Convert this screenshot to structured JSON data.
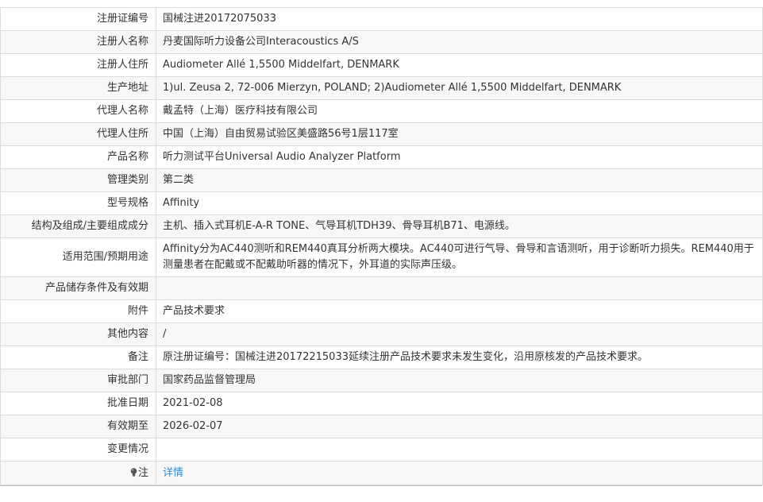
{
  "rows": [
    {
      "label": "注册证编号",
      "value": "国械注进20172075033"
    },
    {
      "label": "注册人名称",
      "value": "丹麦国际听力设备公司Interacoustics A/S"
    },
    {
      "label": "注册人住所",
      "value": "Audiometer Allé 1,5500 Middelfart, DENMARK"
    },
    {
      "label": "生产地址",
      "value": "1)ul. Zeusa 2, 72-006 Mierzyn, POLAND; 2)Audiometer Allé 1,5500 Middelfart, DENMARK"
    },
    {
      "label": "代理人名称",
      "value": "戴孟特（上海）医疗科技有限公司"
    },
    {
      "label": "代理人住所",
      "value": "中国（上海）自由贸易试验区美盛路56号1层117室"
    },
    {
      "label": "产品名称",
      "value": "听力测试平台Universal Audio Analyzer Platform"
    },
    {
      "label": "管理类别",
      "value": "第二类"
    },
    {
      "label": "型号规格",
      "value": "Affinity"
    },
    {
      "label": "结构及组成/主要组成成分",
      "value": "主机、插入式耳机E-A-R TONE、气导耳机TDH39、骨导耳机B71、电源线。"
    },
    {
      "label": "适用范围/预期用途",
      "value": "Affinity分为AC440测听和REM440真耳分析两大模块。AC440可进行气导、骨导和言语测听，用于诊断听力损失。REM440用于测量患者在配戴或不配戴助听器的情况下，外耳道的实际声压级。"
    },
    {
      "label": "产品储存条件及有效期",
      "value": ""
    },
    {
      "label": "附件",
      "value": "产品技术要求"
    },
    {
      "label": "其他内容",
      "value": "/"
    },
    {
      "label": "备注",
      "value": "原注册证编号：国械注进20172215033延续注册产品技术要求未发生变化，沿用原核发的产品技术要求。"
    },
    {
      "label": "审批部门",
      "value": "国家药品监督管理局"
    },
    {
      "label": "批准日期",
      "value": "2021-02-08"
    },
    {
      "label": "有效期至",
      "value": "2026-02-07"
    },
    {
      "label": "变更情况",
      "value": ""
    }
  ],
  "note_row": {
    "label": "注",
    "link_text": "详情",
    "icon": "bulb-icon"
  }
}
